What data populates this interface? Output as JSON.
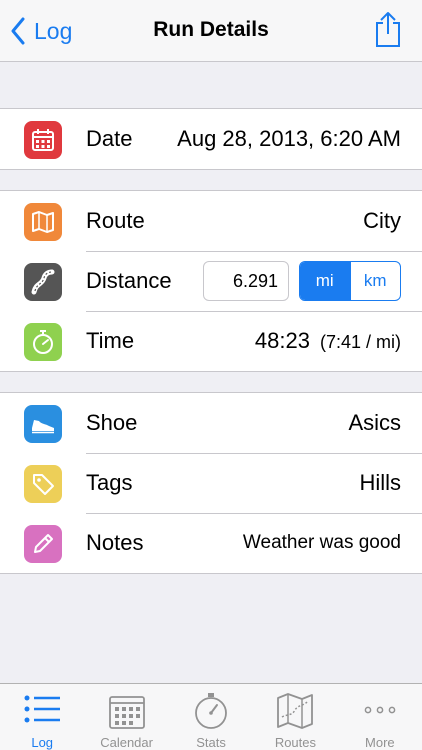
{
  "nav": {
    "back_label": "Log",
    "title": "Run Details"
  },
  "details": {
    "date": {
      "label": "Date",
      "value": "Aug 28, 2013, 6:20 AM"
    },
    "route": {
      "label": "Route",
      "value": "City"
    },
    "distance": {
      "label": "Distance",
      "value": "6.291",
      "units": [
        "mi",
        "km"
      ],
      "selected_unit": "mi"
    },
    "time": {
      "label": "Time",
      "value": "48:23",
      "pace": "(7:41 / mi)"
    },
    "shoe": {
      "label": "Shoe",
      "value": "Asics"
    },
    "tags": {
      "label": "Tags",
      "value": "Hills"
    },
    "notes": {
      "label": "Notes",
      "value": "Weather was good"
    }
  },
  "tabs": [
    {
      "label": "Log",
      "icon": "list-icon",
      "active": true
    },
    {
      "label": "Calendar",
      "icon": "calendar-icon",
      "active": false
    },
    {
      "label": "Stats",
      "icon": "stopwatch-icon",
      "active": false
    },
    {
      "label": "Routes",
      "icon": "map-icon",
      "active": false
    },
    {
      "label": "More",
      "icon": "more-icon",
      "active": false
    }
  ],
  "colors": {
    "accent": "#1a7cf0",
    "date_icon": "#e0393e",
    "route_icon": "#f0883a",
    "distance_icon": "#555555",
    "time_icon": "#8fd14f",
    "shoe_icon": "#2a8fe0",
    "tags_icon": "#edcf58",
    "notes_icon": "#d871c0"
  }
}
